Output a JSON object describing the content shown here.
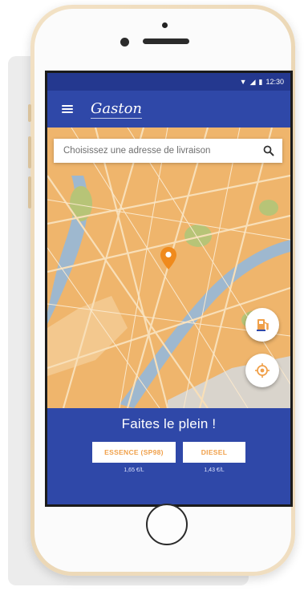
{
  "status_bar": {
    "time": "12:30",
    "icons": [
      "wifi-icon",
      "signal-icon",
      "battery-icon"
    ]
  },
  "app_bar": {
    "menu_icon": "hamburger-menu-icon",
    "brand": "Gaston"
  },
  "search": {
    "placeholder": "Choisissez une adresse de livraison",
    "icon": "search-icon"
  },
  "map": {
    "pin_icon": "location-pin-icon",
    "fab_top_icon": "fuel-pump-icon",
    "fab_bottom_icon": "gps-locate-icon",
    "colors": {
      "land": "#efb56c",
      "water": "#9eb8cf",
      "park": "#b7c477",
      "pin": "#f08a1c"
    }
  },
  "bottom_panel": {
    "title": "Faites le plein !",
    "fuels": [
      {
        "label": "ESSENCE (SP98)",
        "price": "1,65 €/L"
      },
      {
        "label": "DIESEL",
        "price": "1,43 €/L"
      }
    ]
  },
  "colors": {
    "primary": "#2f48a8",
    "primary_dark": "#24388f",
    "accent": "#f0a04a",
    "phone_frame": "#ecd6b2"
  }
}
